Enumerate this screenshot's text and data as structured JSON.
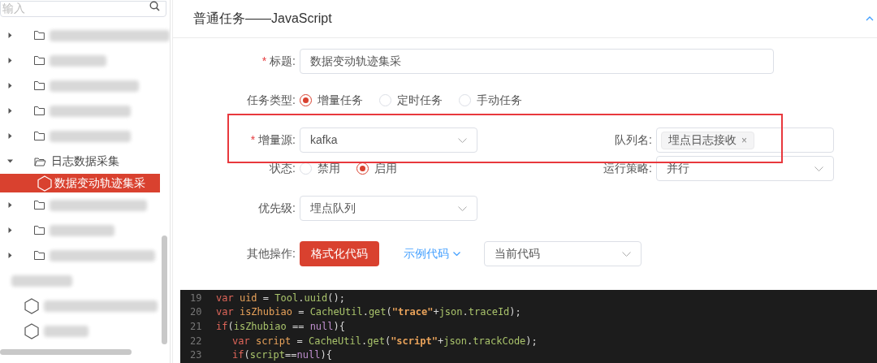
{
  "sidebar": {
    "search": {
      "placeholder": "输入"
    },
    "tree": [
      {
        "kind": "redacted",
        "expanded": false
      },
      {
        "kind": "redacted",
        "expanded": false
      },
      {
        "kind": "redacted",
        "expanded": false
      },
      {
        "kind": "redacted",
        "expanded": false
      },
      {
        "kind": "redacted",
        "expanded": false
      },
      {
        "kind": "folder",
        "label": "日志数据采集",
        "expanded": true,
        "children": [
          {
            "kind": "script",
            "label": "数据变动轨迹集采",
            "selected": true
          }
        ]
      },
      {
        "kind": "redacted",
        "expanded": false
      },
      {
        "kind": "redacted",
        "expanded": false
      },
      {
        "kind": "redacted",
        "expanded": false
      },
      {
        "kind": "redacted-plain"
      },
      {
        "kind": "redacted-script"
      },
      {
        "kind": "redacted-script"
      }
    ]
  },
  "panel": {
    "title": "普通任务——JavaScript",
    "collapsed": false,
    "form": {
      "title": {
        "label": "标题:",
        "required_mark": "*",
        "value": "数据变动轨迹集采"
      },
      "task_type": {
        "label": "任务类型:",
        "options": [
          {
            "label": "增量任务",
            "selected": true
          },
          {
            "label": "定时任务",
            "selected": false
          },
          {
            "label": "手动任务",
            "selected": false
          }
        ]
      },
      "source": {
        "label": "增量源:",
        "required_mark": "*",
        "value": "kafka"
      },
      "queue": {
        "label": "队列名:",
        "tags": [
          "埋点日志接收"
        ],
        "remove": "×"
      },
      "status": {
        "label": "状态:",
        "options": [
          {
            "label": "禁用",
            "selected": false
          },
          {
            "label": "启用",
            "selected": true
          }
        ]
      },
      "strategy": {
        "label": "运行策略:",
        "value": "并行"
      },
      "priority": {
        "label": "优先级:",
        "value": "埋点队列"
      },
      "actions": {
        "label": "其他操作:",
        "format_button": "格式化代码",
        "sample_link": "示例代码",
        "code_select": "当前代码"
      }
    },
    "code": [
      {
        "number": "19",
        "tokens": [
          {
            "kind": "keyword",
            "text": "var "
          },
          {
            "kind": "variable",
            "text": "uid"
          },
          {
            "kind": "plain",
            "text": " = "
          },
          {
            "kind": "class",
            "text": "Tool"
          },
          {
            "kind": "plain",
            "text": "."
          },
          {
            "kind": "class",
            "text": "uuid"
          },
          {
            "kind": "plain",
            "text": "();"
          }
        ]
      },
      {
        "number": "20",
        "tokens": [
          {
            "kind": "keyword",
            "text": "var "
          },
          {
            "kind": "variable",
            "text": "isZhubiao"
          },
          {
            "kind": "plain",
            "text": " = "
          },
          {
            "kind": "class",
            "text": "CacheUtil"
          },
          {
            "kind": "plain",
            "text": "."
          },
          {
            "kind": "class",
            "text": "get"
          },
          {
            "kind": "plain",
            "text": "("
          },
          {
            "kind": "string",
            "text": "\"trace\""
          },
          {
            "kind": "plain",
            "text": "+"
          },
          {
            "kind": "class",
            "text": "json"
          },
          {
            "kind": "plain",
            "text": "."
          },
          {
            "kind": "class",
            "text": "traceId"
          },
          {
            "kind": "plain",
            "text": ");"
          }
        ]
      },
      {
        "number": "21",
        "tokens": [
          {
            "kind": "keyword",
            "text": "if"
          },
          {
            "kind": "plain",
            "text": "("
          },
          {
            "kind": "class",
            "text": "isZhubiao"
          },
          {
            "kind": "plain",
            "text": " == "
          },
          {
            "kind": "literal",
            "text": "null"
          },
          {
            "kind": "plain",
            "text": "){"
          }
        ],
        "children": [
          {
            "number": "22",
            "tokens": [
              {
                "kind": "keyword",
                "text": "var "
              },
              {
                "kind": "variable",
                "text": "script"
              },
              {
                "kind": "plain",
                "text": " = "
              },
              {
                "kind": "class",
                "text": "CacheUtil"
              },
              {
                "kind": "plain",
                "text": "."
              },
              {
                "kind": "class",
                "text": "get"
              },
              {
                "kind": "plain",
                "text": "("
              },
              {
                "kind": "string",
                "text": "\"script\""
              },
              {
                "kind": "plain",
                "text": "+"
              },
              {
                "kind": "class",
                "text": "json"
              },
              {
                "kind": "plain",
                "text": "."
              },
              {
                "kind": "class",
                "text": "trackCode"
              },
              {
                "kind": "plain",
                "text": ");"
              }
            ]
          },
          {
            "number": "23",
            "tokens": [
              {
                "kind": "keyword",
                "text": "if"
              },
              {
                "kind": "plain",
                "text": "("
              },
              {
                "kind": "class",
                "text": "script"
              },
              {
                "kind": "plain",
                "text": "=="
              },
              {
                "kind": "literal",
                "text": "null"
              },
              {
                "kind": "plain",
                "text": "){"
              }
            ]
          }
        ]
      }
    ]
  },
  "highlight_box": true
}
